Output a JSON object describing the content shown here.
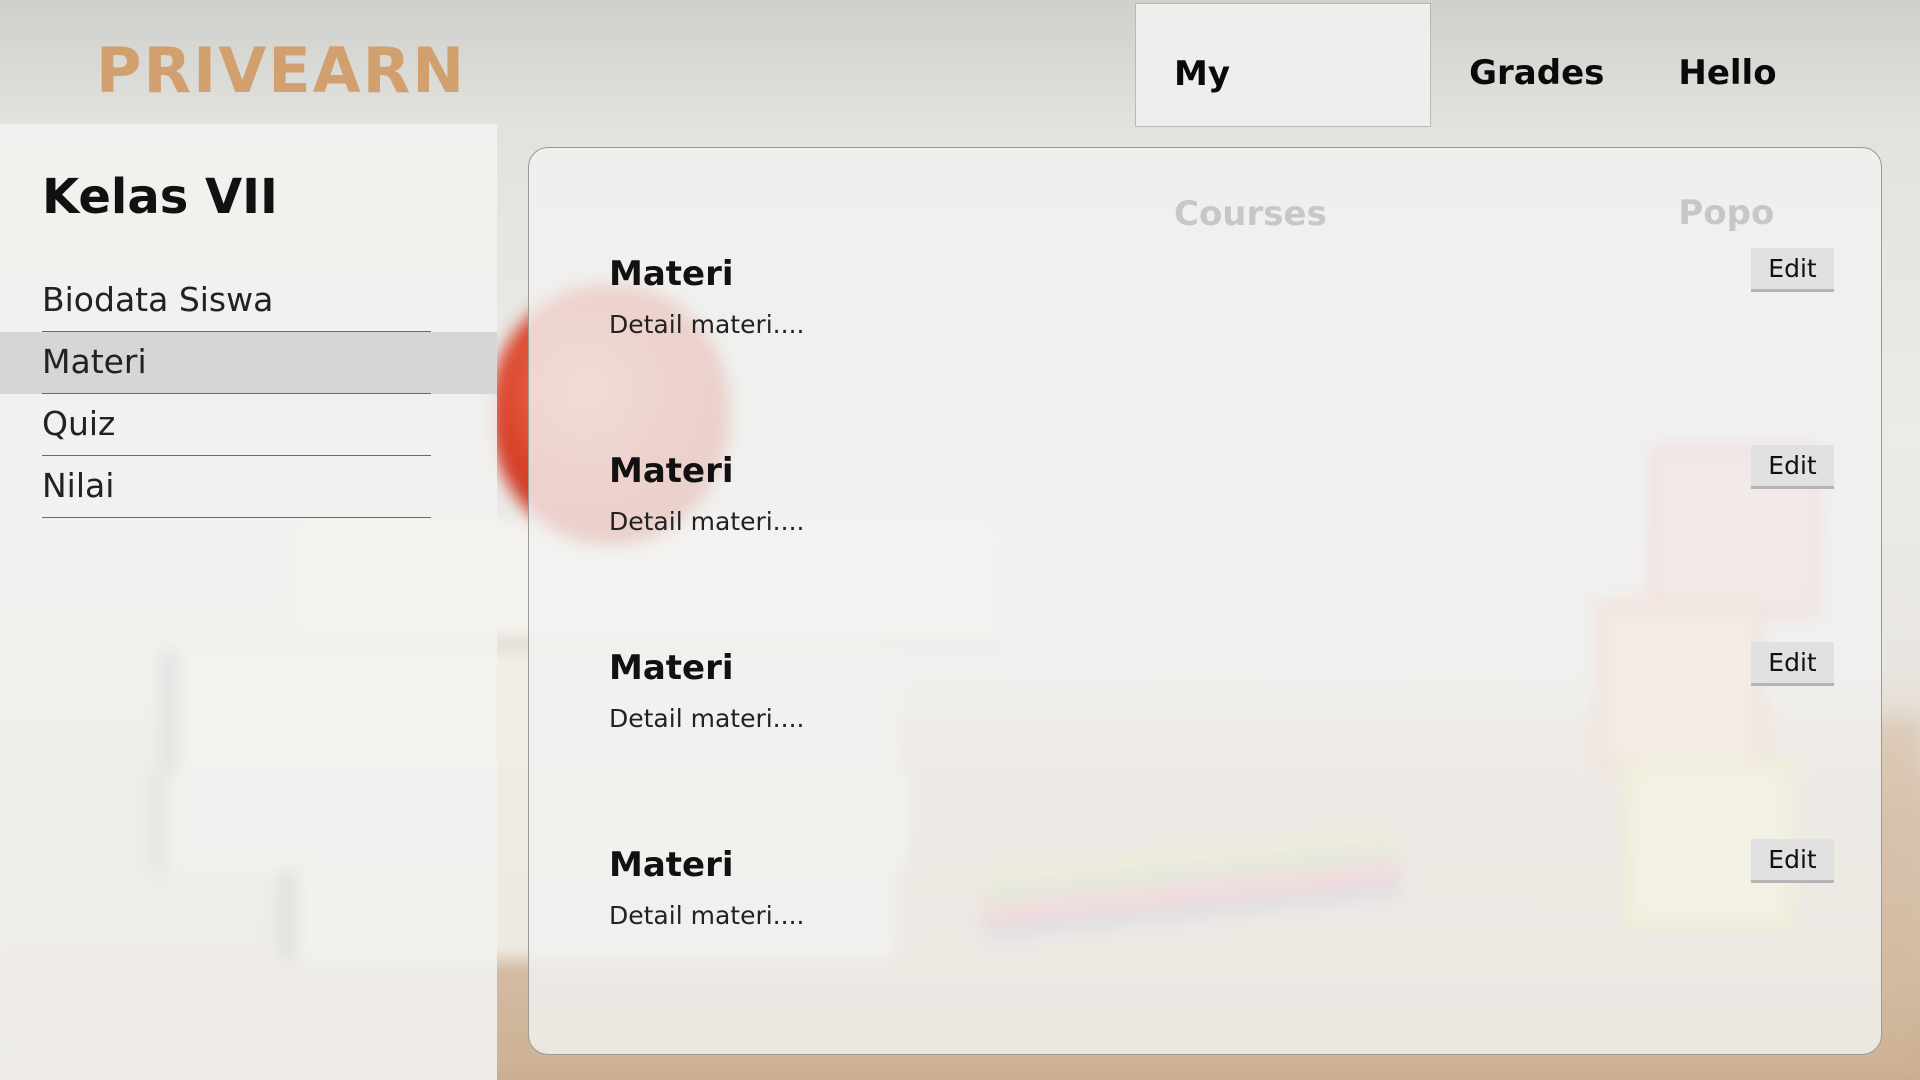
{
  "brand": {
    "logo": "PRIVEARN",
    "logo_color": "#d2a06e"
  },
  "nav": {
    "items": [
      {
        "label": "My Courses",
        "active": true
      },
      {
        "label": "Grades",
        "active": false
      },
      {
        "label": "Hello Popo",
        "active": false
      }
    ]
  },
  "sidebar": {
    "title": "Kelas VII",
    "items": [
      {
        "label": "Biodata Siswa",
        "active": false
      },
      {
        "label": "Materi",
        "active": true
      },
      {
        "label": "Quiz",
        "active": false
      },
      {
        "label": "Nilai",
        "active": false
      }
    ]
  },
  "materials": [
    {
      "title": "Materi",
      "detail": "Detail materi....",
      "edit_label": "Edit"
    },
    {
      "title": "Materi",
      "detail": "Detail materi....",
      "edit_label": "Edit"
    },
    {
      "title": "Materi",
      "detail": "Detail materi....",
      "edit_label": "Edit"
    },
    {
      "title": "Materi",
      "detail": "Detail materi....",
      "edit_label": "Edit"
    }
  ]
}
